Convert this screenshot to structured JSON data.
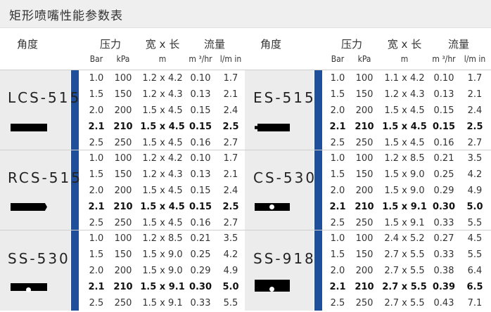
{
  "title": "矩形喷嘴性能参数表",
  "headers": {
    "angle": "角度",
    "pressure": "压力",
    "size": "宽 x 长",
    "flow": "流量",
    "bar": "Bar",
    "kpa": "kPa",
    "m": "m",
    "m3hr": "m ³/hr",
    "lmin": "l/m in"
  },
  "groups": [
    {
      "model": "LCS-515",
      "rows": [
        {
          "bar": "1.0",
          "kpa": "100",
          "size": "1.2 x 4.2",
          "m3hr": "0.10",
          "lmin": "1.7"
        },
        {
          "bar": "1.5",
          "kpa": "150",
          "size": "1.2 x 4.3",
          "m3hr": "0.13",
          "lmin": "2.1"
        },
        {
          "bar": "2.0",
          "kpa": "200",
          "size": "1.5 x 4.5",
          "m3hr": "0.15",
          "lmin": "2.4"
        },
        {
          "bar": "2.1",
          "kpa": "210",
          "size": "1.5 x 4.5",
          "m3hr": "0.15",
          "lmin": "2.5"
        },
        {
          "bar": "2.5",
          "kpa": "250",
          "size": "1.5 x 4.5",
          "m3hr": "0.16",
          "lmin": "2.7"
        }
      ]
    },
    {
      "model": "ES-515",
      "rows": [
        {
          "bar": "1.0",
          "kpa": "100",
          "size": "1.1 x 4.2",
          "m3hr": "0.10",
          "lmin": "1.7"
        },
        {
          "bar": "1.5",
          "kpa": "150",
          "size": "1.2 x 4.3",
          "m3hr": "0.13",
          "lmin": "2.1"
        },
        {
          "bar": "2.0",
          "kpa": "200",
          "size": "1.5 x 4.5",
          "m3hr": "0.15",
          "lmin": "2.4"
        },
        {
          "bar": "2.1",
          "kpa": "210",
          "size": "1.5 x 4.5",
          "m3hr": "0.15",
          "lmin": "2.5"
        },
        {
          "bar": "2.5",
          "kpa": "250",
          "size": "1.5 x 4.5",
          "m3hr": "0.16",
          "lmin": "2.7"
        }
      ]
    },
    {
      "model": "RCS-515",
      "rows": [
        {
          "bar": "1.0",
          "kpa": "100",
          "size": "1.2 x 4.2",
          "m3hr": "0.10",
          "lmin": "1.7"
        },
        {
          "bar": "1.5",
          "kpa": "150",
          "size": "1.2 x 4.3",
          "m3hr": "0.13",
          "lmin": "2.1"
        },
        {
          "bar": "2.0",
          "kpa": "200",
          "size": "1.5 x 4.5",
          "m3hr": "0.15",
          "lmin": "2.4"
        },
        {
          "bar": "2.1",
          "kpa": "210",
          "size": "1.5 x 4.5",
          "m3hr": "0.15",
          "lmin": "2.5"
        },
        {
          "bar": "2.5",
          "kpa": "250",
          "size": "1.5 x 4.5",
          "m3hr": "0.16",
          "lmin": "2.7"
        }
      ]
    },
    {
      "model": "CS-530",
      "rows": [
        {
          "bar": "1.0",
          "kpa": "100",
          "size": "1.2 x 8.5",
          "m3hr": "0.21",
          "lmin": "3.5"
        },
        {
          "bar": "1.5",
          "kpa": "150",
          "size": "1.5 x 9.0",
          "m3hr": "0.25",
          "lmin": "4.2"
        },
        {
          "bar": "2.0",
          "kpa": "200",
          "size": "1.5 x 9.0",
          "m3hr": "0.29",
          "lmin": "4.9"
        },
        {
          "bar": "2.1",
          "kpa": "210",
          "size": "1.5 x 9.1",
          "m3hr": "0.30",
          "lmin": "5.0"
        },
        {
          "bar": "2.5",
          "kpa": "250",
          "size": "1.5 x 9.1",
          "m3hr": "0.33",
          "lmin": "5.5"
        }
      ]
    },
    {
      "model": "SS-530",
      "rows": [
        {
          "bar": "1.0",
          "kpa": "100",
          "size": "1.2 x 8.5",
          "m3hr": "0.21",
          "lmin": "3.5"
        },
        {
          "bar": "1.5",
          "kpa": "150",
          "size": "1.5 x 9.0",
          "m3hr": "0.25",
          "lmin": "4.2"
        },
        {
          "bar": "2.0",
          "kpa": "200",
          "size": "1.5 x 9.0",
          "m3hr": "0.29",
          "lmin": "4.9"
        },
        {
          "bar": "2.1",
          "kpa": "210",
          "size": "1.5 x 9.1",
          "m3hr": "0.30",
          "lmin": "5.0"
        },
        {
          "bar": "2.5",
          "kpa": "250",
          "size": "1.5 x 9.1",
          "m3hr": "0.33",
          "lmin": "5.5"
        }
      ]
    },
    {
      "model": "SS-918",
      "rows": [
        {
          "bar": "1.0",
          "kpa": "100",
          "size": "2.4 x 5.2",
          "m3hr": "0.27",
          "lmin": "4.5"
        },
        {
          "bar": "1.5",
          "kpa": "150",
          "size": "2.7 x 5.5",
          "m3hr": "0.33",
          "lmin": "5.5"
        },
        {
          "bar": "2.0",
          "kpa": "200",
          "size": "2.7 x 5.5",
          "m3hr": "0.38",
          "lmin": "6.4"
        },
        {
          "bar": "2.1",
          "kpa": "210",
          "size": "2.7 x 5.5",
          "m3hr": "0.39",
          "lmin": "6.5"
        },
        {
          "bar": "2.5",
          "kpa": "250",
          "size": "2.7 x 5.5",
          "m3hr": "0.43",
          "lmin": "7.1"
        }
      ]
    }
  ],
  "colors": {
    "accent": "#1f4f9a",
    "group_bg": "#ececec",
    "title_bg": "#efefef"
  }
}
